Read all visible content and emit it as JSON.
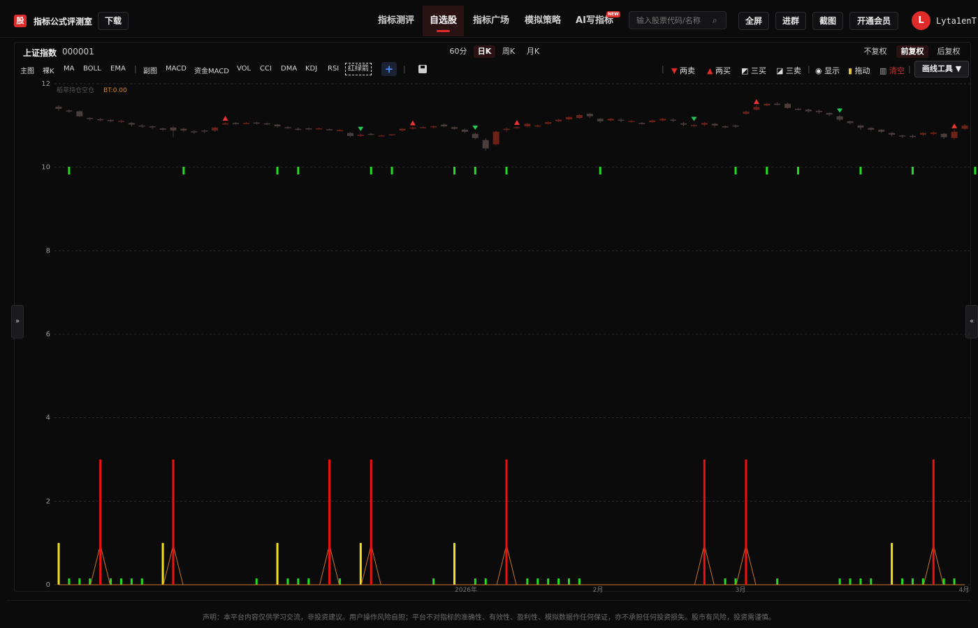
{
  "header": {
    "logo_char": "股",
    "app_title": "指标公式评测室",
    "download": "下载",
    "nav": [
      "指标测评",
      "自选股",
      "指标广场",
      "模拟策略",
      "AI写指标"
    ],
    "new_badge": "NEW",
    "search_placeholder": "输入股票代码/名称",
    "fullscreen": "全屏",
    "join_group": "进群",
    "screenshot": "截图",
    "membership": "开通会员",
    "avatar_letter": "L",
    "username": "Lyta1enT"
  },
  "stock": {
    "name": "上证指数",
    "code": "000001"
  },
  "periods": [
    "60分",
    "日K",
    "周K",
    "月K"
  ],
  "fuquan": [
    "不复权",
    "前复权",
    "后复权"
  ],
  "indicators": {
    "main_label": "主图",
    "main": [
      "裸K",
      "MA",
      "BOLL",
      "EMA"
    ],
    "sub_label": "副图",
    "sub": [
      "MACD",
      "资金MACD",
      "VOL",
      "CCI",
      "DMA",
      "KDJ",
      "RSI"
    ],
    "boxed": "红绿箭"
  },
  "tools": {
    "two_sell": "两卖",
    "two_buy": "两买",
    "three_buy": "三买",
    "three_sell": "三卖",
    "show": "显示",
    "drag": "拖动",
    "clear": "清空",
    "draw_tools": "画线工具"
  },
  "chart_data": {
    "type": "candlestick",
    "legend": {
      "label": "稻草持仓空仓",
      "bt": "BT:0.00"
    },
    "y_ticks": [
      "12",
      "10",
      "8",
      "6",
      "4",
      "2",
      "0"
    ],
    "x_ticks": [
      "2026年",
      "2月",
      "3月",
      "4月"
    ],
    "grid": true,
    "candles": [
      [
        11.45,
        11.4,
        11.48,
        11.35
      ],
      [
        11.36,
        11.34,
        11.38,
        11.3
      ],
      [
        11.34,
        11.22,
        11.36,
        11.2
      ],
      [
        11.18,
        11.16,
        11.2,
        11.12
      ],
      [
        11.15,
        11.13,
        11.18,
        11.1
      ],
      [
        11.13,
        11.12,
        11.15,
        11.08
      ],
      [
        11.1,
        11.11,
        11.14,
        11.06
      ],
      [
        11.06,
        11.02,
        11.08,
        10.98
      ],
      [
        11.0,
        10.99,
        11.03,
        10.95
      ],
      [
        10.98,
        10.96,
        11.0,
        10.92
      ],
      [
        10.93,
        10.9,
        10.95,
        10.86
      ],
      [
        10.95,
        10.88,
        10.97,
        10.72
      ],
      [
        10.92,
        10.88,
        10.95,
        10.84
      ],
      [
        10.86,
        10.85,
        10.89,
        10.8
      ],
      [
        10.88,
        10.87,
        10.9,
        10.82
      ],
      [
        10.88,
        10.95,
        10.97,
        10.85
      ],
      [
        11.04,
        11.05,
        11.08,
        11.02
      ],
      [
        11.06,
        11.05,
        11.08,
        11.02
      ],
      [
        11.05,
        11.06,
        11.08,
        11.03
      ],
      [
        11.07,
        11.05,
        11.09,
        11.02
      ],
      [
        11.05,
        11.04,
        11.07,
        11.01
      ],
      [
        11.02,
        10.98,
        11.04,
        10.95
      ],
      [
        10.96,
        10.95,
        10.98,
        10.92
      ],
      [
        10.92,
        10.91,
        10.95,
        10.88
      ],
      [
        10.93,
        10.92,
        10.95,
        10.89
      ],
      [
        10.92,
        10.93,
        10.95,
        10.9
      ],
      [
        10.91,
        10.9,
        10.93,
        10.88
      ],
      [
        10.88,
        10.89,
        10.91,
        10.86
      ],
      [
        10.82,
        10.75,
        10.84,
        10.72
      ],
      [
        10.75,
        10.78,
        10.8,
        10.73
      ],
      [
        10.8,
        10.79,
        10.82,
        10.77
      ],
      [
        10.76,
        10.76,
        10.78,
        10.74
      ],
      [
        10.78,
        10.79,
        10.8,
        10.75
      ],
      [
        10.88,
        10.92,
        10.94,
        10.86
      ],
      [
        10.93,
        10.95,
        10.97,
        10.9
      ],
      [
        10.95,
        10.96,
        10.98,
        10.93
      ],
      [
        10.96,
        10.98,
        11.0,
        10.93
      ],
      [
        11.02,
        10.98,
        11.05,
        10.96
      ],
      [
        10.96,
        10.92,
        10.98,
        10.9
      ],
      [
        10.9,
        10.85,
        10.93,
        10.82
      ],
      [
        10.8,
        10.7,
        10.83,
        10.67
      ],
      [
        10.65,
        10.45,
        10.7,
        10.4
      ],
      [
        10.55,
        10.85,
        10.88,
        10.52
      ],
      [
        10.9,
        10.92,
        10.95,
        10.85
      ],
      [
        10.95,
        10.96,
        10.98,
        10.92
      ],
      [
        10.98,
        11.04,
        11.06,
        10.96
      ],
      [
        10.98,
        11.0,
        11.02,
        10.96
      ],
      [
        11.04,
        11.08,
        11.1,
        11.02
      ],
      [
        11.1,
        11.14,
        11.16,
        11.08
      ],
      [
        11.15,
        11.2,
        11.22,
        11.13
      ],
      [
        11.18,
        11.25,
        11.28,
        11.16
      ],
      [
        11.28,
        11.22,
        11.3,
        11.18
      ],
      [
        11.16,
        11.1,
        11.18,
        11.06
      ],
      [
        11.12,
        11.16,
        11.18,
        11.1
      ],
      [
        11.14,
        11.12,
        11.17,
        11.08
      ],
      [
        11.1,
        11.11,
        11.13,
        11.06
      ],
      [
        11.06,
        11.05,
        11.08,
        11.02
      ],
      [
        11.08,
        11.12,
        11.14,
        11.06
      ],
      [
        11.12,
        11.16,
        11.18,
        11.1
      ],
      [
        11.14,
        11.12,
        11.17,
        11.08
      ],
      [
        11.05,
        11.02,
        11.08,
        10.98
      ],
      [
        11.0,
        11.01,
        11.04,
        10.96
      ],
      [
        11.02,
        11.06,
        11.08,
        10.98
      ],
      [
        11.04,
        11.0,
        11.06,
        10.96
      ],
      [
        10.98,
        10.97,
        11.0,
        10.94
      ],
      [
        11.0,
        10.99,
        11.02,
        10.95
      ],
      [
        11.28,
        11.33,
        11.36,
        11.26
      ],
      [
        11.38,
        11.44,
        11.48,
        11.36
      ],
      [
        11.48,
        11.52,
        11.54,
        11.46
      ],
      [
        11.52,
        11.5,
        11.56,
        11.48
      ],
      [
        11.52,
        11.42,
        11.55,
        11.4
      ],
      [
        11.4,
        11.39,
        11.42,
        11.36
      ],
      [
        11.38,
        11.34,
        11.4,
        11.32
      ],
      [
        11.35,
        11.32,
        11.38,
        11.28
      ],
      [
        11.3,
        11.26,
        11.32,
        11.22
      ],
      [
        11.22,
        11.14,
        11.24,
        11.1
      ],
      [
        11.1,
        11.06,
        11.12,
        11.02
      ],
      [
        11.0,
        10.95,
        11.02,
        10.9
      ],
      [
        10.94,
        10.9,
        10.96,
        10.86
      ],
      [
        10.9,
        10.85,
        10.92,
        10.82
      ],
      [
        10.82,
        10.78,
        10.84,
        10.74
      ],
      [
        10.76,
        10.74,
        10.78,
        10.7
      ],
      [
        10.75,
        10.73,
        10.78,
        10.7
      ],
      [
        10.78,
        10.82,
        10.84,
        10.75
      ],
      [
        10.8,
        10.83,
        10.86,
        10.77
      ],
      [
        10.8,
        10.72,
        10.82,
        10.68
      ],
      [
        10.7,
        10.85,
        10.9,
        10.66
      ],
      [
        10.92,
        11.0,
        11.04,
        10.9
      ]
    ],
    "sell_arrows_index": [
      29,
      40,
      61,
      75
    ],
    "buy_arrows_index": [
      16,
      34,
      44,
      67,
      86
    ],
    "green_upper_index": [
      1,
      12,
      21,
      23,
      30,
      32,
      38,
      40,
      43,
      52,
      65,
      68,
      71,
      77,
      82,
      88
    ],
    "sub_chart": {
      "red_spikes_index": [
        4,
        11,
        26,
        30,
        43,
        62,
        66,
        84
      ],
      "yellow_index": [
        0,
        10,
        21,
        29,
        38,
        80,
        89
      ],
      "green_index": [
        1,
        2,
        3,
        5,
        6,
        7,
        8,
        19,
        22,
        23,
        24,
        27,
        36,
        40,
        41,
        45,
        46,
        47,
        48,
        49,
        50,
        64,
        65,
        66,
        69,
        75,
        76,
        77,
        78,
        81,
        82,
        83,
        85,
        86
      ],
      "red_value": 3,
      "yellow_value": 1,
      "green_value": 0.15
    }
  },
  "disclaimer": "声明：本平台内容仅供学习交流，非投资建议。用户操作风险自担；平台不对指标的准确性、有效性、盈利性、模拟数据作任何保证，亦不承担任何投资损失。股市有风险，投资需谨慎。"
}
